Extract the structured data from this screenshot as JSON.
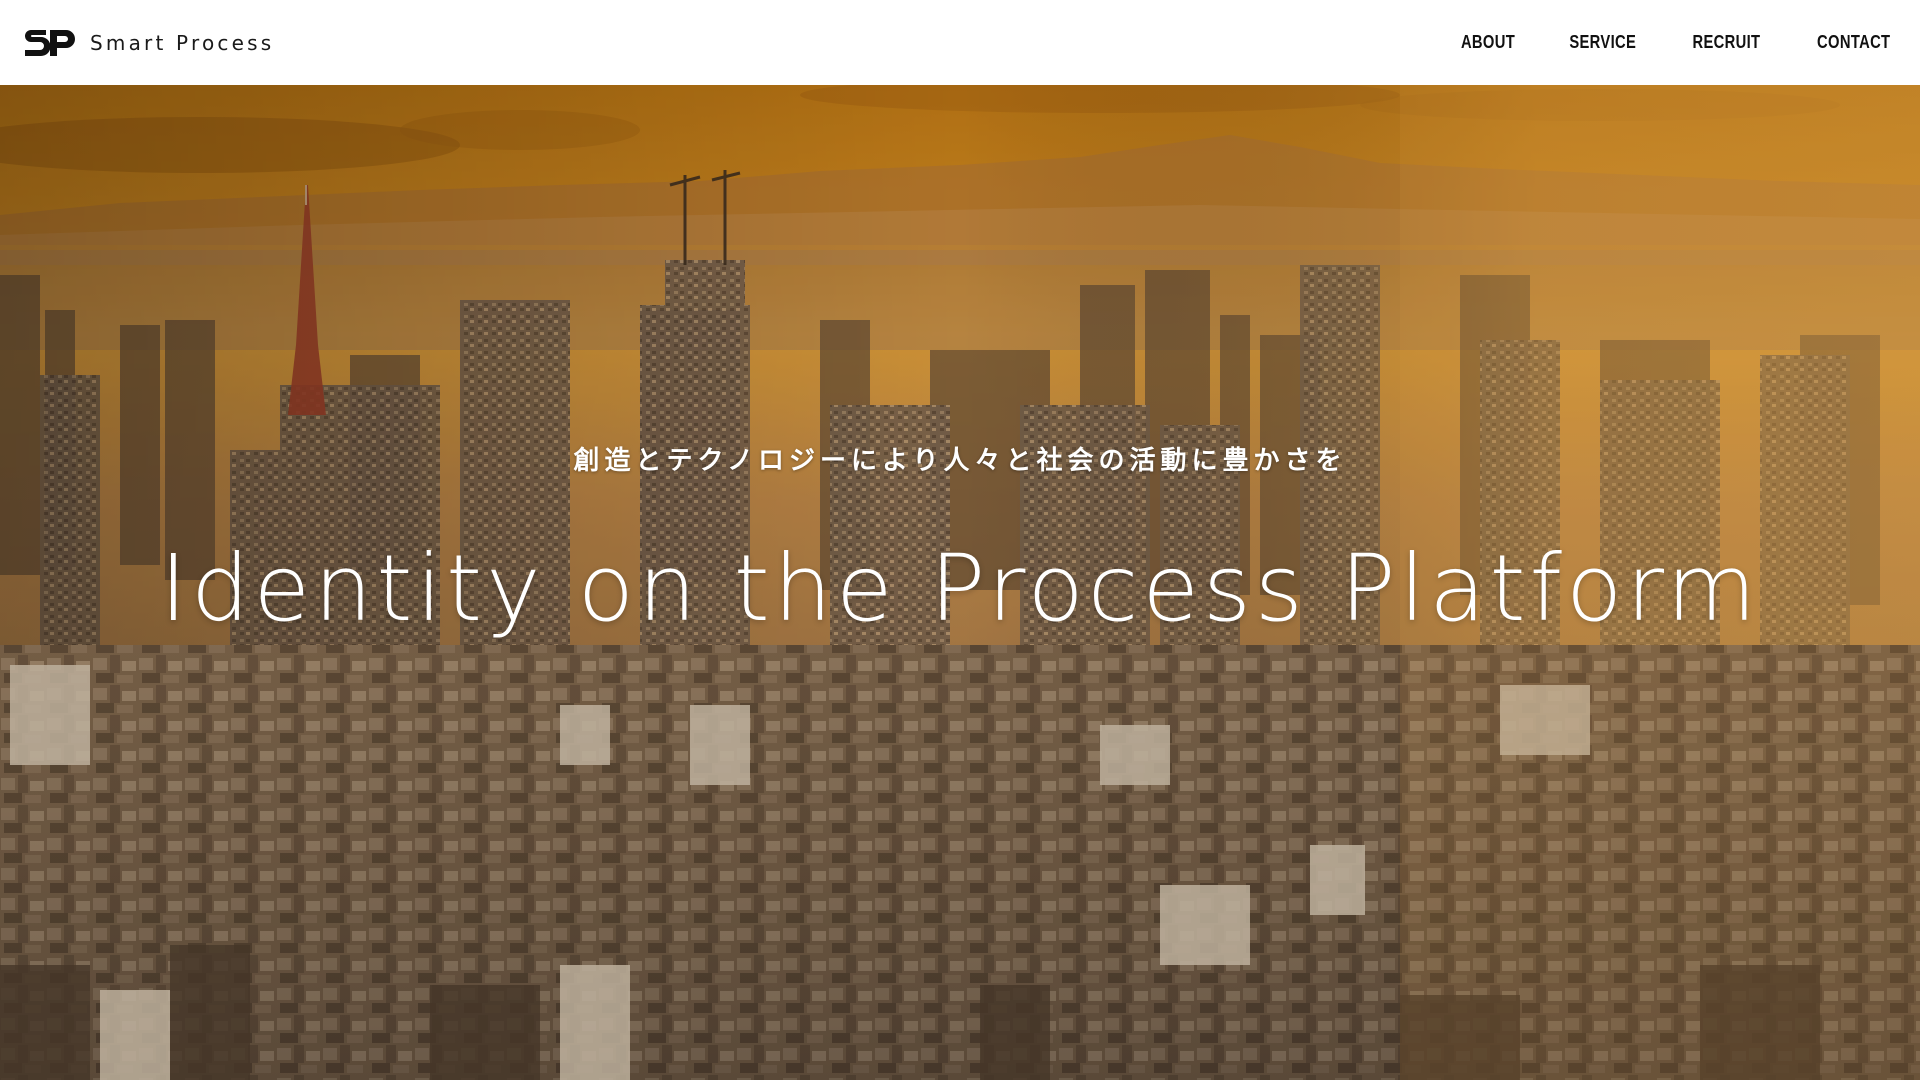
{
  "header": {
    "brand": {
      "logo_text": "SP",
      "name": "Smart Process"
    },
    "nav": [
      {
        "label": "ABOUT"
      },
      {
        "label": "SERVICE"
      },
      {
        "label": "RECRUIT"
      },
      {
        "label": "CONTACT"
      }
    ]
  },
  "hero": {
    "tagline": "創造とテクノロジーにより人々と社会の活動に豊かさを",
    "title": "Identity on the Process Platform",
    "background": "city-skyline-sunset-image",
    "colors": {
      "sky_top": "#c9821e",
      "sky_horizon": "#e2a23c",
      "haze": "#c98a3a",
      "city_dark": "#4a3a2c",
      "city_mid": "#8a6d50"
    }
  }
}
